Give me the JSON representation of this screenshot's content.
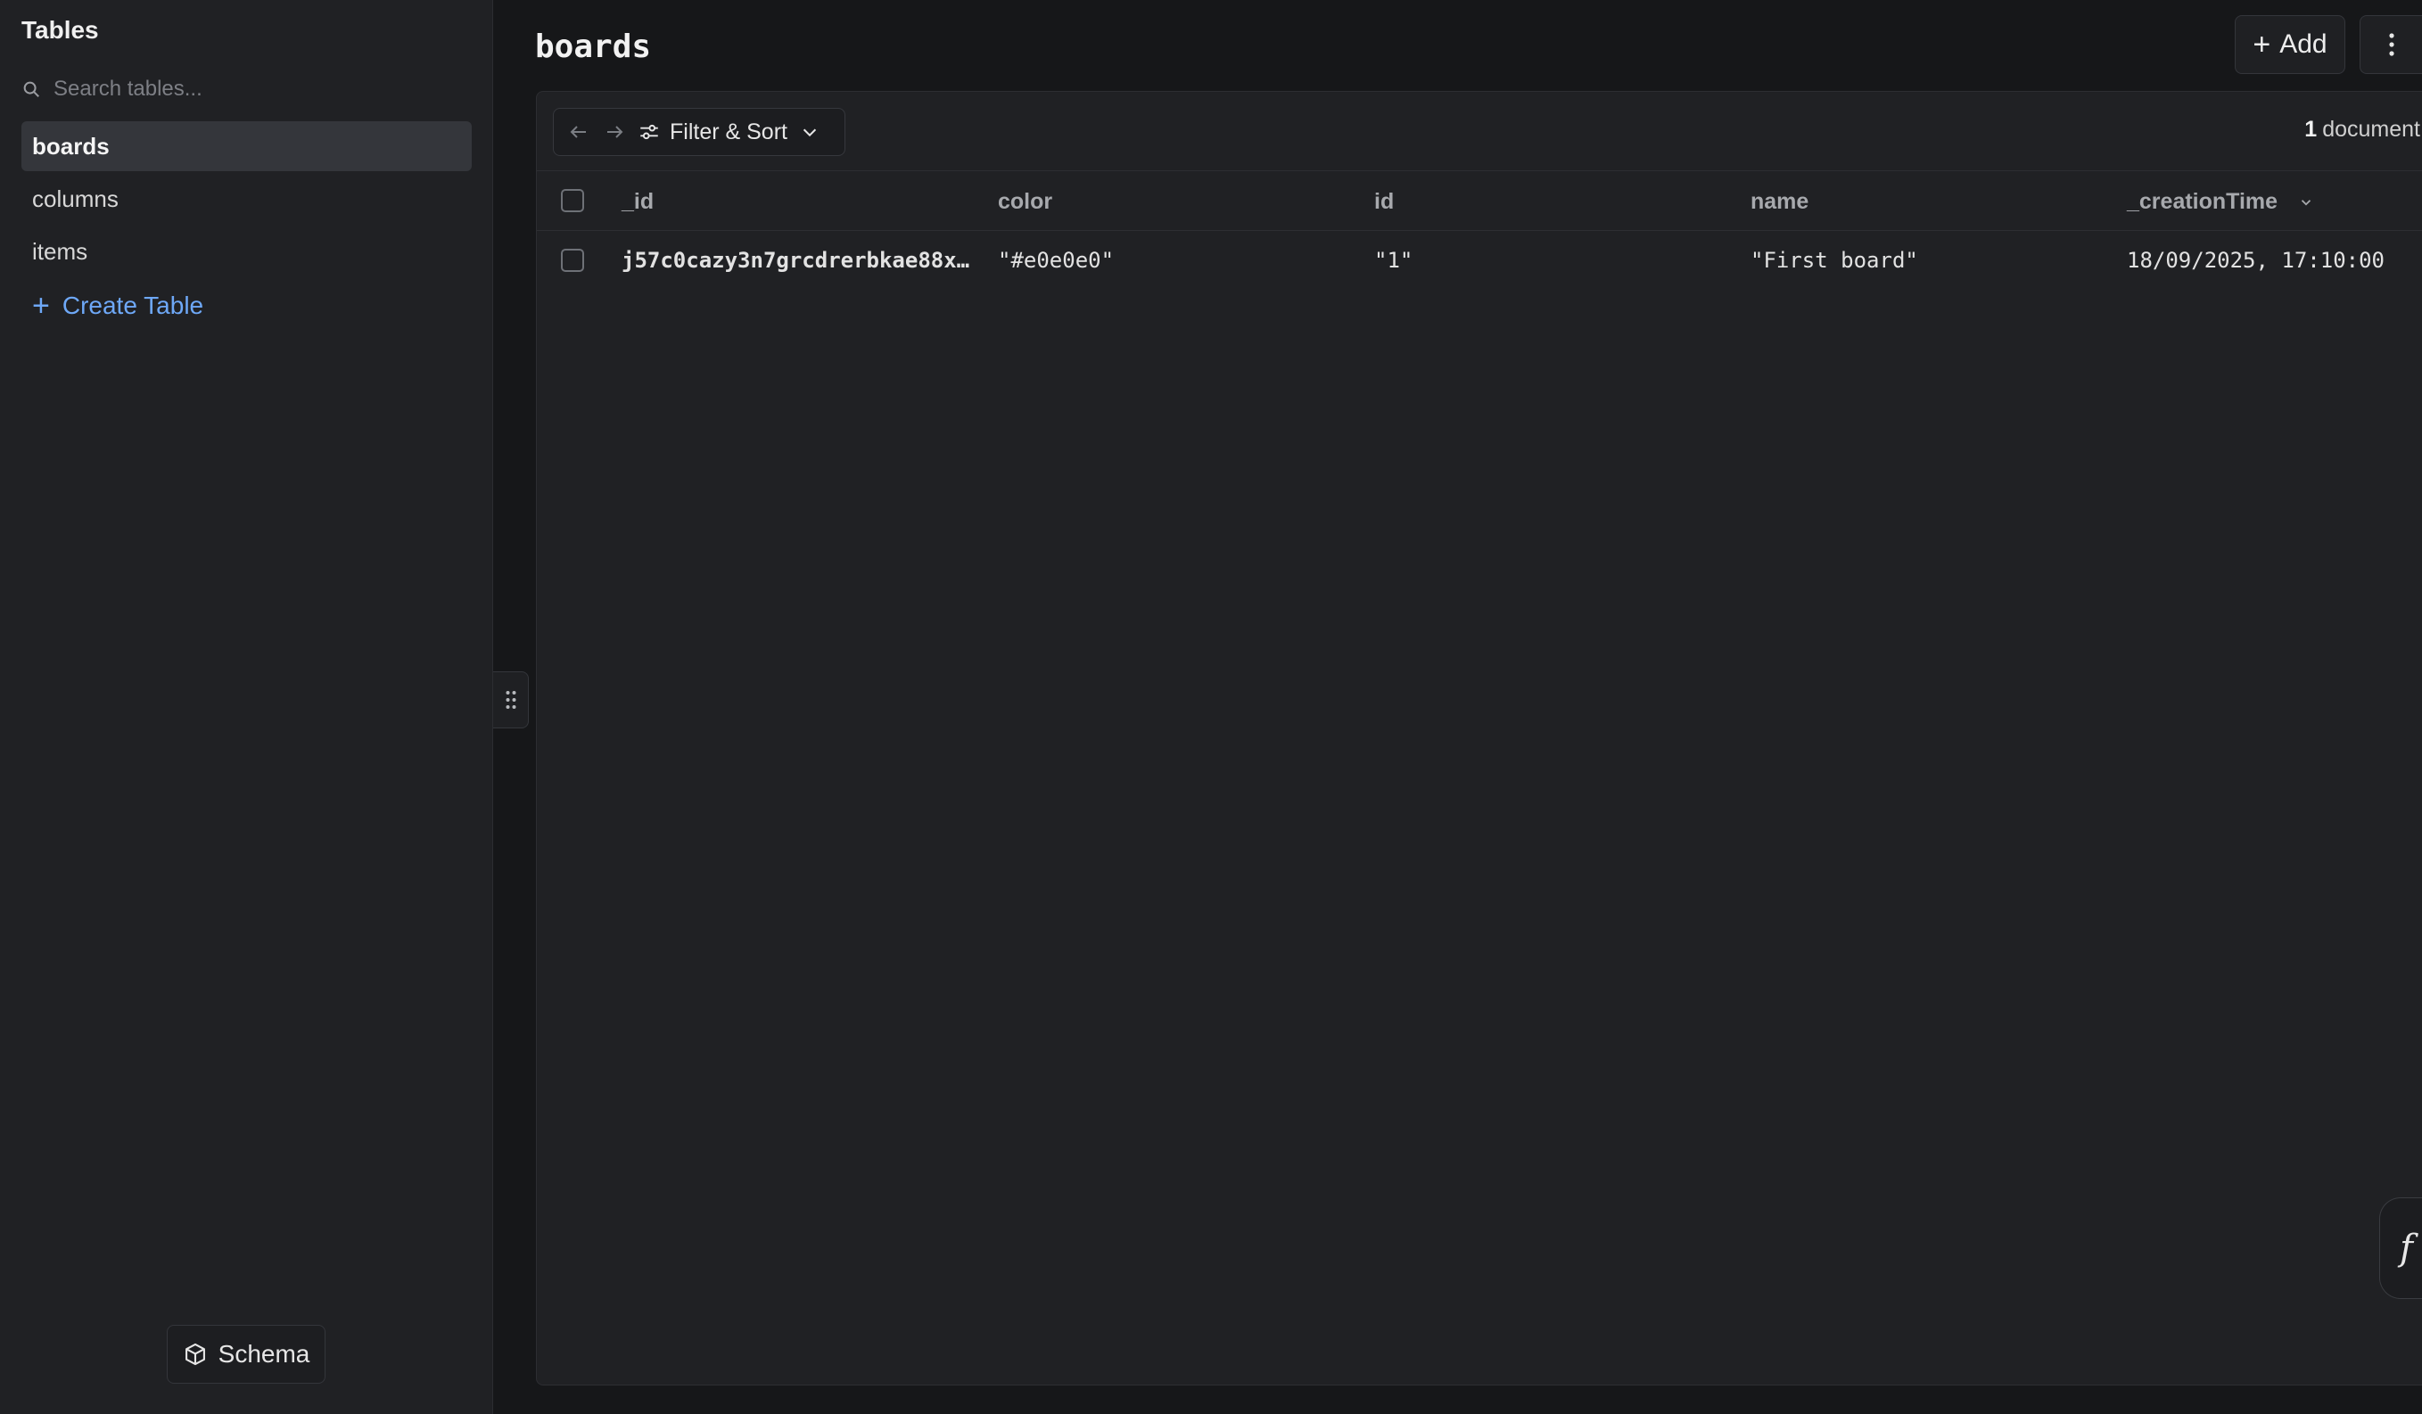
{
  "sidebar": {
    "title": "Tables",
    "search_placeholder": "Search tables...",
    "tables": [
      {
        "label": "boards",
        "active": true
      },
      {
        "label": "columns",
        "active": false
      },
      {
        "label": "items",
        "active": false
      }
    ],
    "create_label": "Create Table",
    "schema_label": "Schema"
  },
  "header": {
    "title": "boards",
    "add_label": "Add"
  },
  "toolbar": {
    "filter_label": "Filter & Sort",
    "doc_count": "1",
    "doc_count_label": "document"
  },
  "table": {
    "columns": [
      "_id",
      "color",
      "id",
      "name",
      "_creationTime"
    ],
    "rows": [
      {
        "_id": "j57c0cazy3n7grcdrerbkae88x…",
        "color": "\"#e0e0e0\"",
        "id": "\"1\"",
        "name": "\"First board\"",
        "_creationTime": "18/09/2025, 17:10:00"
      }
    ]
  },
  "fx_tab_label": "f",
  "colors": {
    "accent": "#6ea8f7",
    "sidebar_bg": "#202124",
    "page_bg": "#161719"
  }
}
